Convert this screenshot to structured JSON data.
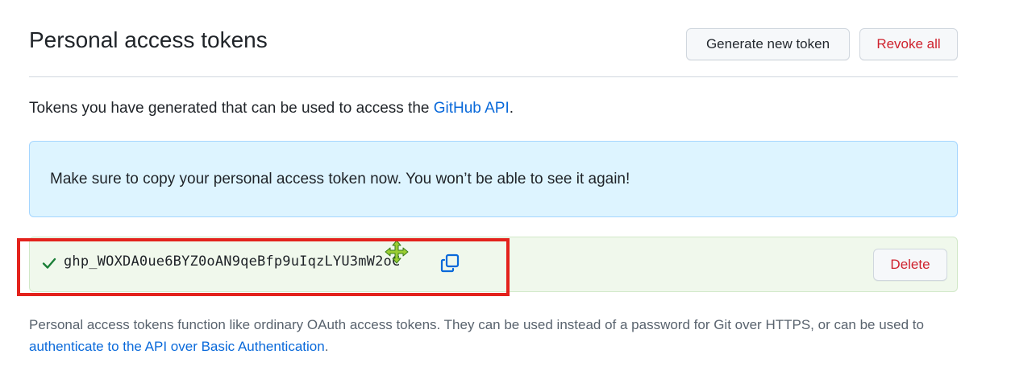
{
  "header": {
    "title": "Personal access tokens",
    "generate_label": "Generate new token",
    "revoke_label": "Revoke all"
  },
  "intro": {
    "text": "Tokens you have generated that can be used to access the ",
    "link": "GitHub API",
    "suffix": "."
  },
  "flash": {
    "message": "Make sure to copy your personal access token now. You won’t be able to see it again!"
  },
  "token": {
    "value": "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",
    "delete_label": "Delete",
    "status_icon": "check-icon",
    "copy_icon": "copy-icon"
  },
  "footnote": {
    "text": "Personal access tokens function like ordinary OAuth access tokens. They can be used instead of a password for Git over HTTPS, or can be used to ",
    "link": "authenticate to the API over Basic Authentication",
    "suffix": "."
  },
  "colors": {
    "accent": "#0969da",
    "danger": "#cf222e",
    "success": "#1a7f37",
    "flash_bg": "#ddf4ff",
    "token_bg": "#f0f8ec",
    "highlight": "#e3221c"
  }
}
